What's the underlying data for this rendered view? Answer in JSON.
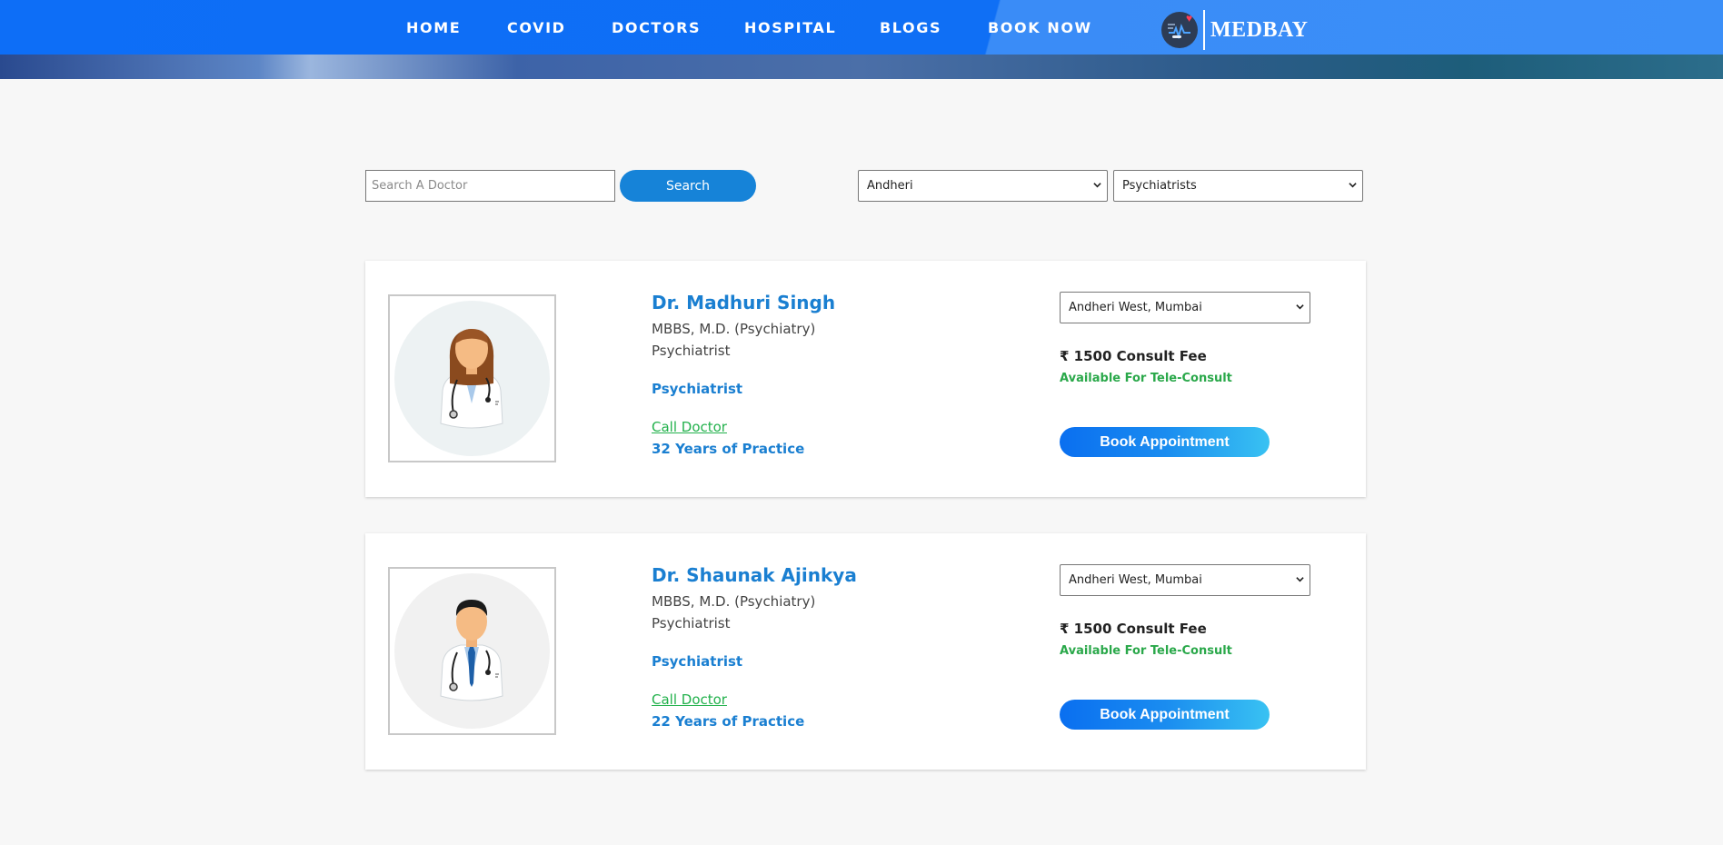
{
  "nav": {
    "items": [
      {
        "label": "HOME"
      },
      {
        "label": "COVID"
      },
      {
        "label": "DOCTORS"
      },
      {
        "label": "HOSPITAL"
      },
      {
        "label": "BLOGS"
      },
      {
        "label": "BOOK NOW"
      }
    ],
    "logo_text": "MEDBAY",
    "logo_icon": "heart-pulse-icon"
  },
  "search": {
    "placeholder": "Search A Doctor",
    "value": "",
    "button_label": "Search",
    "location_selected": "Andheri",
    "specialty_selected": "Psychiatrists"
  },
  "doctors": [
    {
      "name": "Dr. Madhuri Singh",
      "qualification": "MBBS, M.D. (Psychiatry)",
      "role": "Psychiatrist",
      "specialty": "Psychiatrist",
      "call_label": "Call Doctor",
      "experience": "32 Years of Practice",
      "location_selected": "Andheri West, Mumbai",
      "fee": "₹ 1500 Consult Fee",
      "tele": "Available For Tele-Consult",
      "book_label": "Book Appointment",
      "avatar": "female-doctor-avatar"
    },
    {
      "name": "Dr. Shaunak Ajinkya",
      "qualification": "MBBS, M.D. (Psychiatry)",
      "role": "Psychiatrist",
      "specialty": "Psychiatrist",
      "call_label": "Call Doctor",
      "experience": "22 Years of Practice",
      "location_selected": "Andheri West, Mumbai",
      "fee": "₹ 1500 Consult Fee",
      "tele": "Available For Tele-Consult",
      "book_label": "Book Appointment",
      "avatar": "male-doctor-avatar"
    }
  ],
  "colors": {
    "nav_blue": "#0d6ef7",
    "accent_blue": "#1a7fd1",
    "green": "#22b14c"
  }
}
